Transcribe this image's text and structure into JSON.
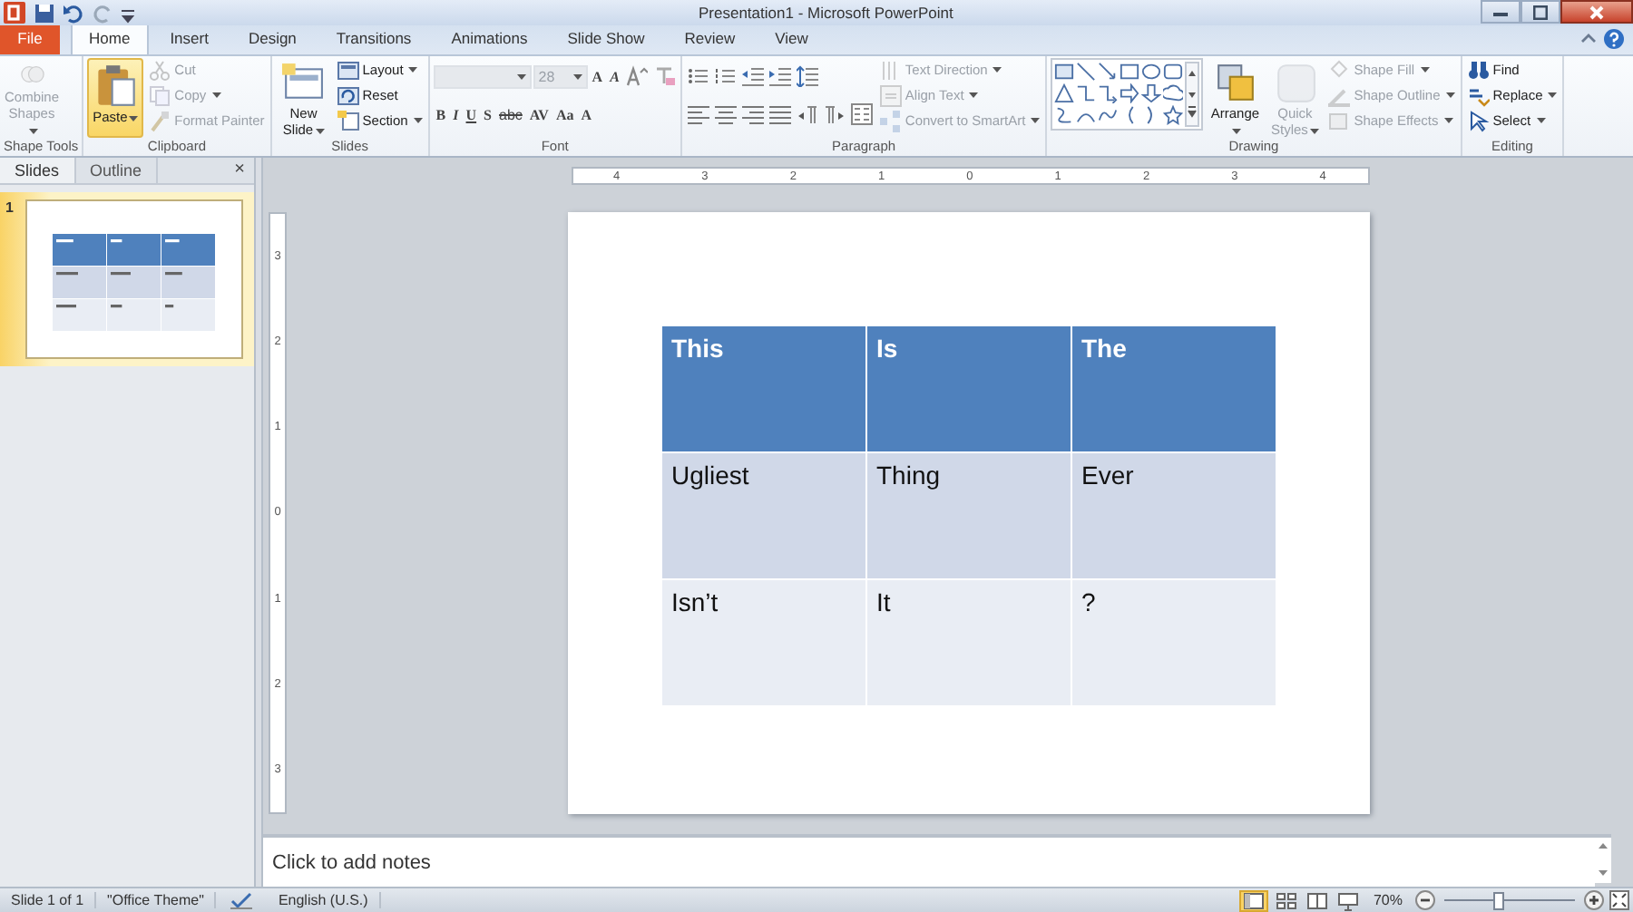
{
  "window": {
    "title": "Presentation1 - Microsoft PowerPoint"
  },
  "ribbon_tabs": [
    {
      "label": "File",
      "kind": "file",
      "selected": false
    },
    {
      "label": "Home",
      "kind": "tab",
      "selected": true
    },
    {
      "label": "Insert",
      "kind": "tab",
      "selected": false
    },
    {
      "label": "Design",
      "kind": "tab",
      "selected": false
    },
    {
      "label": "Transitions",
      "kind": "tab",
      "selected": false
    },
    {
      "label": "Animations",
      "kind": "tab",
      "selected": false
    },
    {
      "label": "Slide Show",
      "kind": "tab",
      "selected": false
    },
    {
      "label": "Review",
      "kind": "tab",
      "selected": false
    },
    {
      "label": "View",
      "kind": "tab",
      "selected": false
    }
  ],
  "ribbon_groups": [
    {
      "label": "Shape Tools",
      "columns": [
        [
          {
            "kind": "large",
            "label": "Combine Shapes",
            "dropdown": true,
            "disabled": true,
            "highlighted": false
          }
        ]
      ]
    },
    {
      "label": "Clipboard",
      "columns": [
        [
          {
            "kind": "large",
            "label": "Paste",
            "dropdown": true,
            "disabled": false,
            "highlighted": true
          }
        ],
        [
          {
            "kind": "small",
            "label": "Cut",
            "dropdown": false,
            "disabled": true
          },
          {
            "kind": "small",
            "label": "Copy",
            "dropdown": true,
            "disabled": true
          },
          {
            "kind": "small",
            "label": "Format Painter",
            "dropdown": false,
            "disabled": true
          }
        ]
      ]
    },
    {
      "label": "Slides",
      "columns": [
        [
          {
            "kind": "large",
            "label": "New Slide",
            "dropdown": true,
            "disabled": false,
            "highlighted": false
          }
        ],
        [
          {
            "kind": "small",
            "label": "Layout",
            "dropdown": true,
            "disabled": false
          },
          {
            "kind": "small",
            "label": "Reset",
            "dropdown": false,
            "disabled": false
          },
          {
            "kind": "small",
            "label": "Section",
            "dropdown": true,
            "disabled": false
          }
        ]
      ]
    },
    {
      "label": "Font",
      "columns": [
        [
          {
            "kind": "row",
            "items": [
              {
                "kind": "field",
                "disabled": true
              },
              {
                "kind": "field",
                "value": "28",
                "disabled": true
              },
              {
                "kind": "glyphs",
                "labels": [
                  "A",
                  "A"
                ]
              },
              {
                "kind": "tools"
              }
            ]
          },
          {
            "kind": "row",
            "items": [
              {
                "kind": "glyphs",
                "labels": [
                  "B",
                  "I",
                  "U",
                  "S",
                  "abc",
                  "AV",
                  "Aa",
                  "A"
                ]
              }
            ]
          }
        ]
      ]
    },
    {
      "label": "Paragraph",
      "columns": [
        [
          {
            "kind": "row",
            "items": [
              {
                "kind": "tools"
              }
            ]
          },
          {
            "kind": "row",
            "items": [
              {
                "kind": "tools"
              }
            ]
          }
        ],
        [
          {
            "kind": "small",
            "label": "Text Direction",
            "dropdown": true,
            "disabled": true
          },
          {
            "kind": "small",
            "label": "Align Text",
            "dropdown": true,
            "disabled": true
          },
          {
            "kind": "small",
            "label": "Convert to SmartArt",
            "dropdown": true,
            "disabled": true
          }
        ]
      ]
    },
    {
      "label": "Drawing",
      "columns": [
        [
          {
            "kind": "gallery"
          }
        ],
        [
          {
            "kind": "large",
            "label": "Arrange",
            "dropdown": true,
            "disabled": false,
            "highlighted": false
          }
        ],
        [
          {
            "kind": "large",
            "label": "Quick Styles",
            "dropdown": true,
            "disabled": true,
            "highlighted": false
          }
        ],
        [
          {
            "kind": "small",
            "label": "Shape Fill",
            "dropdown": true,
            "disabled": true
          },
          {
            "kind": "small",
            "label": "Shape Outline",
            "dropdown": true,
            "disabled": true
          },
          {
            "kind": "small",
            "label": "Shape Effects",
            "dropdown": true,
            "disabled": true
          }
        ]
      ]
    },
    {
      "label": "Editing",
      "columns": [
        [
          {
            "kind": "small",
            "label": "Find",
            "dropdown": false,
            "disabled": false
          },
          {
            "kind": "small",
            "label": "Replace",
            "dropdown": true,
            "disabled": false
          },
          {
            "kind": "small",
            "label": "Select",
            "dropdown": true,
            "disabled": false
          }
        ]
      ]
    }
  ],
  "sidebar": {
    "tabs": [
      {
        "label": "Slides",
        "selected": true
      },
      {
        "label": "Outline",
        "selected": false
      }
    ],
    "close": "×",
    "slides": [
      {
        "number": "1",
        "selected": true
      }
    ]
  },
  "horizontal_ruler": {
    "labels": [
      "4",
      "3",
      "2",
      "1",
      "0",
      "1",
      "2",
      "3",
      "4"
    ]
  },
  "vertical_ruler": {
    "labels": [
      "3",
      "2",
      "1",
      "0",
      "1",
      "2",
      "3"
    ]
  },
  "slide": {
    "table": {
      "rows": [
        {
          "kind": "header",
          "cells": [
            "This",
            "Is",
            "The"
          ]
        },
        {
          "kind": "band",
          "cells": [
            "Ugliest",
            "Thing",
            "Ever"
          ]
        },
        {
          "kind": "plain",
          "cells": [
            "Isn’t",
            "It",
            "?"
          ]
        }
      ]
    }
  },
  "notes": {
    "placeholder": "Click to add notes"
  },
  "status_bar": {
    "items": [
      "Slide 1 of 1",
      "\"Office Theme\"",
      "English (U.S.)"
    ],
    "views": [
      {
        "selected": true
      },
      {
        "selected": false
      },
      {
        "selected": false
      },
      {
        "selected": false
      }
    ],
    "zoom": {
      "reading": "70%",
      "level": 0.42
    }
  }
}
